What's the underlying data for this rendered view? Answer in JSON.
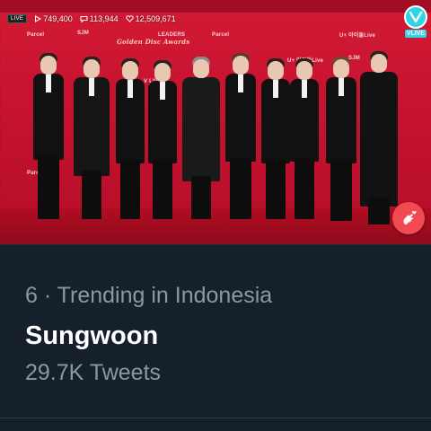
{
  "video": {
    "live_label": "LIVE",
    "views": "749,400",
    "comments": "113,944",
    "hearts": "12,509,671",
    "brand_label": "VLIVE",
    "backdrop_logos": [
      "Parcel",
      "SJM",
      "LEADERS",
      "Parcel",
      "U+ 아이돌Live",
      "Golden Disc Awards",
      "V LIVE",
      "U+ 아이돌Live",
      "SJM",
      "Parcel"
    ]
  },
  "trend": {
    "rank_context": "6 · Trending in Indonesia",
    "name": "Sungwoon",
    "tweet_count": "29.7K Tweets"
  },
  "colors": {
    "backdrop_red": "#c8102e",
    "app_background": "#15202b",
    "secondary_text": "#8899a6",
    "primary_text": "#ffffff",
    "vlive_cyan": "#2fd5e5",
    "heart_button": "#f24a52"
  },
  "icons": {
    "views": "play-icon",
    "comments": "comment-icon",
    "hearts": "heart-icon",
    "vlive": "vlive-logo",
    "finger_heart": "finger-heart-icon"
  }
}
